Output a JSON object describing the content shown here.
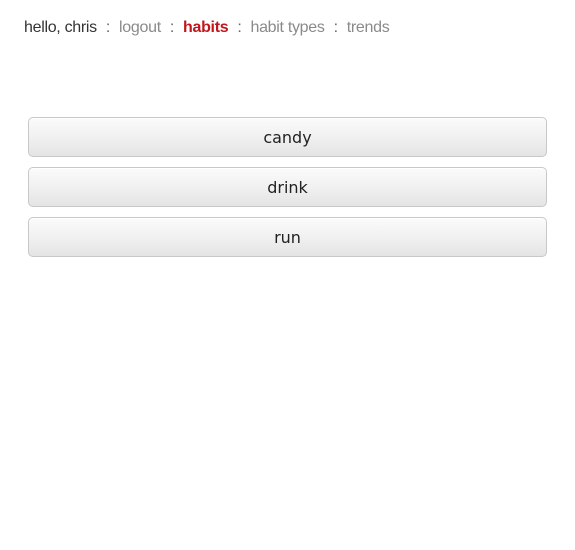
{
  "nav": {
    "greeting": "hello, chris",
    "separator": ":",
    "links": [
      {
        "label": "logout",
        "active": false
      },
      {
        "label": "habits",
        "active": true
      },
      {
        "label": "habit types",
        "active": false
      },
      {
        "label": "trends",
        "active": false
      }
    ],
    "colors": {
      "active": "#c0171d",
      "inactive": "#8a8a8a",
      "text": "#333333"
    }
  },
  "habits": [
    {
      "label": "candy"
    },
    {
      "label": "drink"
    },
    {
      "label": "run"
    }
  ]
}
